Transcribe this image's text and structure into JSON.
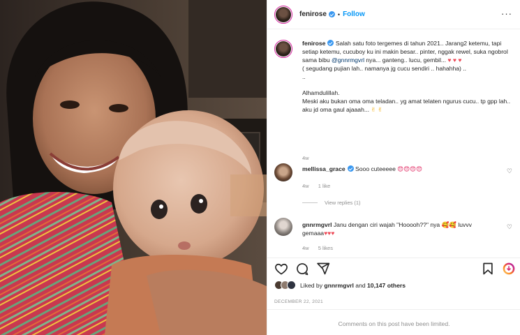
{
  "post": {
    "username": "fenirose",
    "follow_label": "Follow",
    "more_label": "···"
  },
  "caption": {
    "username": "fenirose",
    "line1": " Salah satu foto tergemes di tahun 2021.. Jarang2 ketemu, tapi setiap ketemu, cucuboy ku ini makin besar.. pinter, nggak rewel, suka ngobrol sama bibu ",
    "mention": "@gnnrmgvrl",
    "line2": " nya... ganteng.. lucu, gembil... ",
    "hearts": "♥ ♥ ♥",
    "line3": "( segudang pujian lah.. namanya jg cucu sendiri .. hahahha) ..",
    "line4": "..",
    "line5": "Alhamdulillah.",
    "line6": "Meski aku bukan oma oma teladan.. yg amat telaten ngurus cucu.. tp gpp lah.. aku jd oma gaul ajaaah... ",
    "hands": "✌ ✌",
    "time": "4w"
  },
  "comments": [
    {
      "username": "mellissa_grace",
      "text": " Sooo cuteeeee ",
      "emoji": "😍😍😍😍",
      "time": "4w",
      "likes": "1 like"
    },
    {
      "username": "gnnrmgvrl",
      "text": " Janu dengan ciri wajah \"Hooooh??\" nya ",
      "emoji": "🥰🥰",
      "text2": " luvvv gemaaa",
      "hearts": "♥♥♥",
      "time": "4w",
      "likes": "5 likes"
    }
  ],
  "view_replies": "View replies (1)",
  "likes": {
    "prefix": "Liked by ",
    "user": "gnnrmgvrl",
    "middle": " and ",
    "count": "10,147 others"
  },
  "date": "DECEMBER 22, 2021",
  "comments_limited": "Comments on this post have been limited.",
  "colors": {
    "accent": "#0095f6",
    "verified": "#3897f0",
    "heart": "#ed4956",
    "story_ring": "#d6249f"
  },
  "icons": [
    "verified-icon",
    "heart-icon",
    "comment-icon",
    "share-icon",
    "bookmark-icon",
    "reels-icon"
  ]
}
